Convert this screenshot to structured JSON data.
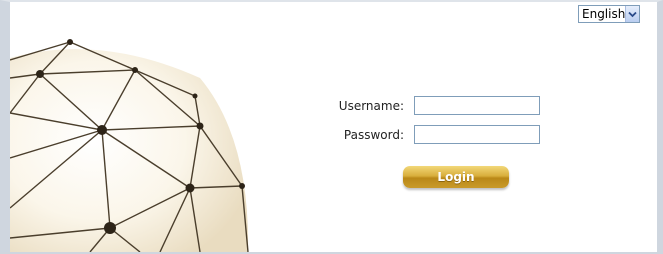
{
  "language": {
    "selected": "English",
    "icon": "chevron-down-icon"
  },
  "login_form": {
    "username_label": "Username:",
    "username_value": "",
    "password_label": "Password:",
    "password_value": "",
    "submit_label": "Login"
  },
  "colors": {
    "button_gold": "#d8ae3c",
    "frame_border": "#cfd6df",
    "input_border": "#7f9db9"
  }
}
